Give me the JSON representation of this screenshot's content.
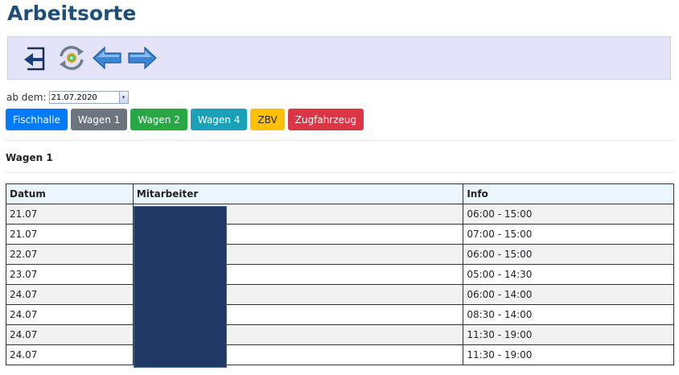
{
  "page": {
    "title": "Arbeitsorte"
  },
  "toolbar": {
    "icons": [
      "exit-icon",
      "refresh-icon",
      "arrow-left-icon",
      "arrow-right-icon"
    ]
  },
  "filter": {
    "label": "ab dem:",
    "date_value": "21.07.2020"
  },
  "buttons": [
    {
      "label": "Fischhalle",
      "color": "#007bff"
    },
    {
      "label": "Wagen 1",
      "color": "#6c757d"
    },
    {
      "label": "Wagen 2",
      "color": "#28a745"
    },
    {
      "label": "Wagen 4",
      "color": "#17a2b8"
    },
    {
      "label": "ZBV",
      "color": "#ffc107"
    },
    {
      "label": "Zugfahrzeug",
      "color": "#dc3545"
    }
  ],
  "section": {
    "title": "Wagen 1"
  },
  "table": {
    "headers": {
      "date": "Datum",
      "employee": "Mitarbeiter",
      "info": "Info"
    },
    "rows": [
      {
        "date": "21.07",
        "info": "06:00 - 15:00"
      },
      {
        "date": "21.07",
        "info": "07:00 - 15:00"
      },
      {
        "date": "22.07",
        "info": "06:00 - 15:00"
      },
      {
        "date": "23.07",
        "info": "05:00 - 14:30"
      },
      {
        "date": "24.07",
        "info": "06:00 - 14:00"
      },
      {
        "date": "24.07",
        "info": "08:30 - 14:00"
      },
      {
        "date": "24.07",
        "info": "11:30 - 19:00"
      },
      {
        "date": "24.07",
        "info": "11:30 - 19:00"
      }
    ]
  }
}
